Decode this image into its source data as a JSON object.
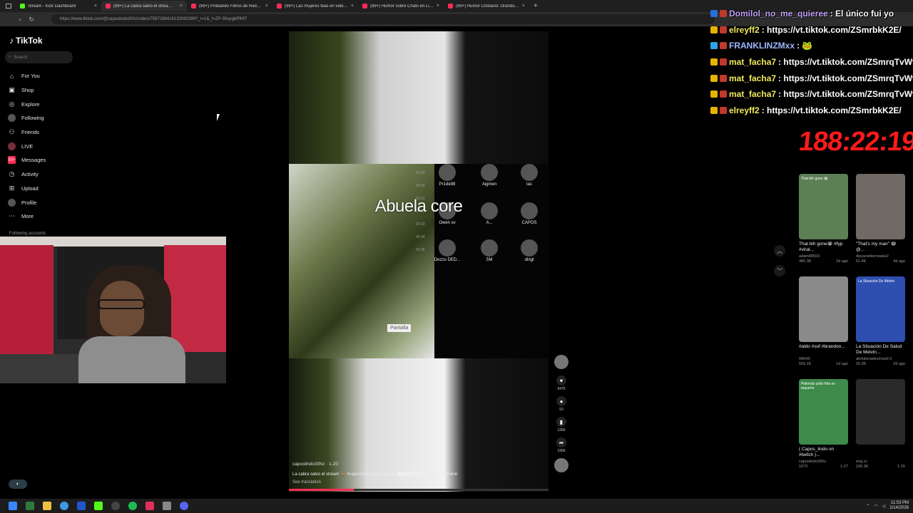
{
  "browser": {
    "tabs": [
      {
        "label": "Stream - Kick Dashboard",
        "icon": "kick"
      },
      {
        "label": "(99+) La cabra salvo el strea...",
        "icon": "tt",
        "active": true
      },
      {
        "label": "(99+) Probando Filtros de Redes S...",
        "icon": "tt"
      },
      {
        "label": "(99+) Las mujeres feas en videos ...",
        "icon": "tt"
      },
      {
        "label": "(99+) Humor sobre Chats en Línea...",
        "icon": "tt"
      },
      {
        "label": "(99+) Humor Cristiano: Orando c...",
        "icon": "tt"
      }
    ],
    "url": "https://www.tiktok.com/@caposlindo30hz/video/7597298416133082399?_r=1&_t=ZP-93vpgbPfHf7"
  },
  "sidebar": {
    "logo": "TikTok",
    "search_placeholder": "Search",
    "items": [
      {
        "label": "For You",
        "icon": "home-icon",
        "glyph": "⌂"
      },
      {
        "label": "Shop",
        "icon": "shop-icon",
        "glyph": "▣"
      },
      {
        "label": "Explore",
        "icon": "compass-icon",
        "glyph": "◎"
      },
      {
        "label": "Following",
        "icon": "following-avatar-icon",
        "glyph": ""
      },
      {
        "label": "Friends",
        "icon": "friends-icon",
        "glyph": "⚇"
      },
      {
        "label": "LIVE",
        "icon": "live-icon",
        "glyph": ""
      },
      {
        "label": "Messages",
        "icon": "messages-icon",
        "glyph": "99+"
      },
      {
        "label": "Activity",
        "icon": "activity-icon",
        "glyph": "◷"
      },
      {
        "label": "Upload",
        "icon": "upload-icon",
        "glyph": "⊞"
      },
      {
        "label": "Profile",
        "icon": "profile-icon",
        "glyph": ""
      },
      {
        "label": "More",
        "icon": "more-icon",
        "glyph": "⋯"
      }
    ],
    "following_accounts": "Following accounts"
  },
  "video": {
    "overlay_caption": "Abuela core",
    "users": [
      "Pr1de98",
      "Aigmen",
      "las",
      "Owen sv",
      "A...",
      "CAPOS",
      "Dezzu DED...",
      "SM",
      "dingl"
    ],
    "slot_nums": [
      "00 99",
      "00 99",
      "00 01",
      "00 02",
      "00 03",
      "00 04",
      "00 05"
    ],
    "pantalla": "Pantalla",
    "author": "caposlindo30hz · 1-20",
    "description": "La cabra salvo el stream 🐐 #caposlindo #clips #parati ████████████ #clips #viral",
    "see_translation": "See translation",
    "progress": 0.25
  },
  "actions": [
    {
      "name": "author-avatar",
      "count": ""
    },
    {
      "name": "like",
      "glyph": "♥",
      "count": "9475"
    },
    {
      "name": "comment",
      "glyph": "●",
      "count": "53"
    },
    {
      "name": "save",
      "glyph": "▮",
      "count": "1266"
    },
    {
      "name": "share",
      "glyph": "➦",
      "count": "1956"
    },
    {
      "name": "sound",
      "count": ""
    }
  ],
  "chat": [
    {
      "user": "Domilol_no_me_quieree",
      "msg": ": El único fui yo",
      "color": "purple"
    },
    {
      "user": "elreyff2",
      "msg": ": https://vt.tiktok.com/ZSmrbkK2E/",
      "color": "yellow"
    },
    {
      "user": "FRANKLINZMxx",
      "msg": ": 🐸",
      "color": "blue"
    },
    {
      "user": "mat_facha7",
      "msg": ": https://vt.tiktok.com/ZSmrqTvWv/htt",
      "color": "yellow"
    },
    {
      "user": "mat_facha7",
      "msg": ": https://vt.tiktok.com/ZSmrqTvWv/htt",
      "color": "yellow"
    },
    {
      "user": "mat_facha7",
      "msg": ": https://vt.tiktok.com/ZSmrqTvWv/htt",
      "color": "yellow"
    },
    {
      "user": "elreyff2",
      "msg": ": https://vt.tiktok.com/ZSmrbkK2E/",
      "color": "yellow"
    }
  ],
  "timer": "188:22:19",
  "cards": [
    {
      "title": "That bih gone😭 #fyp #viral...",
      "author": "adam88593",
      "views": "480.3K",
      "date": "2d ago",
      "thumb": "That bih gone 😭",
      "bg": "#5d7f55"
    },
    {
      "title": "\"That's my man\" 😂 @...",
      "author": "dwyaneblemeake2",
      "views": "61.4K",
      "date": "4d ago",
      "thumb": "",
      "bg": "#6f6a64"
    },
    {
      "title": "#aldo #sof #brandon...",
      "author": "0964S",
      "views": "509.1K",
      "date": "1d ago",
      "thumb": "",
      "bg": "#8a8a8a"
    },
    {
      "title": "La Situación De Salud De Melvin...",
      "author": "alofokeradioshow2.0",
      "views": "25.3K",
      "date": "2d ago",
      "thumb": "La Situación De Melvin",
      "bg": "#2f4fb0"
    },
    {
      "title": "( Capos_lindo on #twitch )...",
      "author": "caposlindo30hz",
      "views": "1573",
      "date": "1-27",
      "thumb": "Pidiendo pollo frito en taquería",
      "bg": "#3d8a4a"
    },
    {
      "title": "",
      "author": "eng.cc",
      "views": "106.3K",
      "date": "1-15",
      "thumb": "",
      "bg": "#2a2a2a"
    }
  ],
  "taskbar": {
    "time": "11:53 PM",
    "date": "2/14/2026"
  },
  "colors": {
    "accent": "#fe2c55",
    "timer": "#ff1a1a",
    "chat_user": "#f3e95c"
  }
}
